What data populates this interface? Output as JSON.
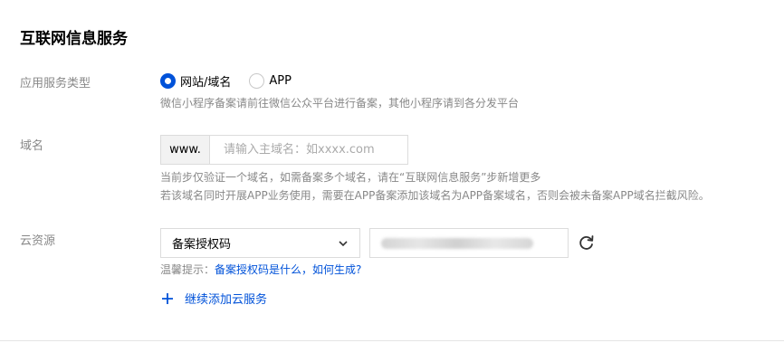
{
  "section": {
    "title": "互联网信息服务"
  },
  "service_type": {
    "label": "应用服务类型",
    "options": [
      {
        "label": "网站/域名",
        "checked": true
      },
      {
        "label": "APP",
        "checked": false
      }
    ],
    "hint": "微信小程序备案请前往微信公众平台进行备案，其他小程序请到各分发平台"
  },
  "domain": {
    "label": "域名",
    "prefix": "www.",
    "value": "",
    "placeholder": "请输入主域名：如xxxx.com",
    "hint_line1": "当前步仅验证一个域名，如需备案多个域名，请在“互联网信息服务”步新增更多",
    "hint_line2": "若该域名同时开展APP业务使用，需要在APP备案添加该域名为APP备案域名，否则会被未备案APP域名拦截风险。"
  },
  "cloud_resource": {
    "label": "云资源",
    "select_value": "备案授权码",
    "tip_label": "温馨提示：",
    "tip_link": "备案授权码是什么，如何生成?",
    "add_label": "继续添加云服务"
  },
  "colors": {
    "accent": "#0052d9",
    "muted": "#888888",
    "border": "#dcdcdc"
  },
  "icons": [
    "chevron-down-icon",
    "refresh-icon",
    "plus-icon"
  ]
}
